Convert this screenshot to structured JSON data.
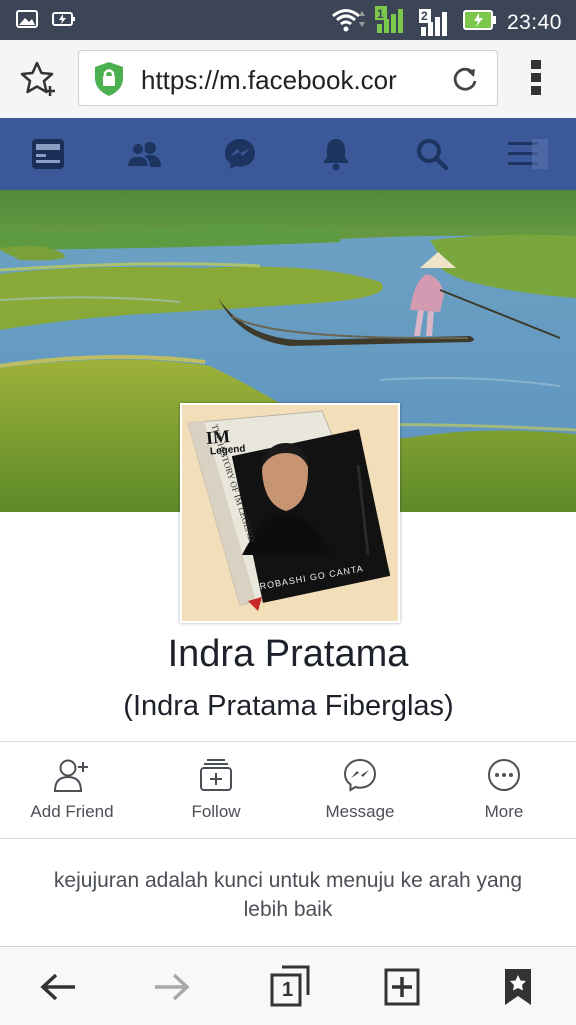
{
  "status_bar": {
    "time": "23:40",
    "sim2_label": "2"
  },
  "browser": {
    "url": "https://m.facebook.cor",
    "tabs_count": "1"
  },
  "profile": {
    "name": "Indra Pratama",
    "alternate_name": "(Indra Pratama Fiberglas)",
    "bio": "kejujuran adalah kunci untuk menuju ke arah yang lebih baik",
    "profile_picture_book_text": {
      "logo": "IM",
      "logo_sub": "Legend",
      "spine": "THE HISTORY OF IM LEGEND",
      "author": "PROBASHI GO CANTA"
    }
  },
  "actions": [
    {
      "label": "Add Friend",
      "icon": "add-friend-icon"
    },
    {
      "label": "Follow",
      "icon": "follow-icon"
    },
    {
      "label": "Message",
      "icon": "messenger-icon"
    },
    {
      "label": "More",
      "icon": "more-icon"
    }
  ],
  "colors": {
    "facebook_blue": "#3b5998",
    "status_bar": "#3b4556",
    "secure_lock_green": "#4caf50"
  }
}
